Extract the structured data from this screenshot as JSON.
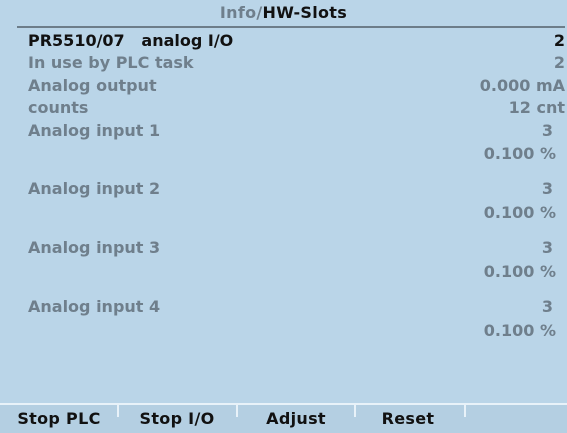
{
  "title": {
    "path": "Info/",
    "current": "HW-Slots"
  },
  "rows": [
    {
      "label": "PR5510/07   analog I/O",
      "value": "2",
      "style": "primary"
    },
    {
      "label": "In use by PLC task",
      "value": "2",
      "style": "secondary"
    },
    {
      "label": "Analog output",
      "value": "0.000 mA",
      "style": "secondary"
    },
    {
      "label": "counts",
      "value": "12 cnt",
      "style": "secondary"
    },
    {
      "label": "Analog input 1",
      "value": "3",
      "style": "secondary"
    },
    {
      "label": "",
      "value": "0.100 %",
      "style": "secondary"
    },
    {
      "label": "Analog input 2",
      "value": "3",
      "style": "secondary"
    },
    {
      "label": "",
      "value": "0.100 %",
      "style": "secondary"
    },
    {
      "label": "Analog input 3",
      "value": "3",
      "style": "secondary"
    },
    {
      "label": "",
      "value": "0.100 %",
      "style": "secondary"
    },
    {
      "label": "Analog input 4",
      "value": "3",
      "style": "secondary"
    },
    {
      "label": "",
      "value": "0.100 %",
      "style": "secondary"
    }
  ],
  "softkeys": [
    {
      "label": "Stop PLC"
    },
    {
      "label": "Stop I/O"
    },
    {
      "label": "Adjust"
    },
    {
      "label": "Reset"
    },
    {
      "label": ""
    }
  ]
}
